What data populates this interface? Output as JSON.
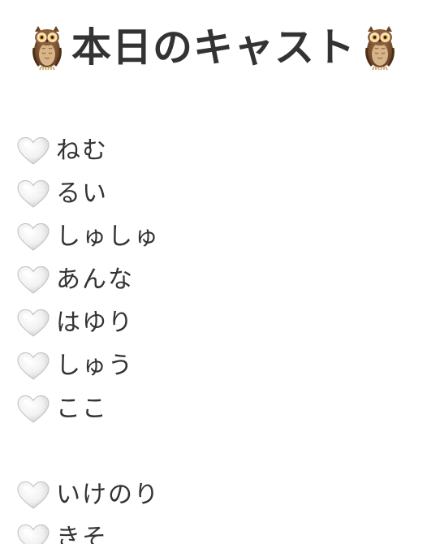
{
  "header": {
    "title": "本日のキャスト",
    "left_icon": "owl-emoji",
    "right_icon": "owl-emoji"
  },
  "cast": {
    "item_icon": "white-heart-emoji",
    "names": [
      "ねむ",
      "るい",
      "しゅしゅ",
      "あんな",
      "はゆり",
      "しゅう",
      "ここ",
      "いけのり",
      "きそ"
    ]
  }
}
